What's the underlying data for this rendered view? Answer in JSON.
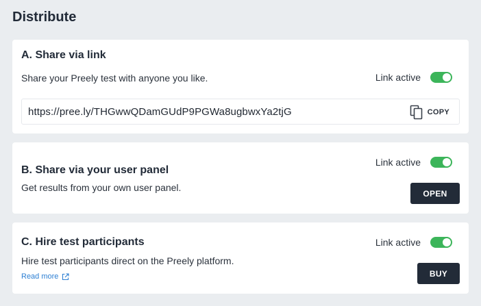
{
  "page": {
    "title": "Distribute"
  },
  "colors": {
    "toggle_on": "#3cb55a",
    "dark_button": "#222b38",
    "link": "#2d7fd3"
  },
  "share_link": {
    "title": "A. Share via link",
    "description": "Share your Preely test with anyone you like.",
    "toggle_label": "Link active",
    "toggle_on": true,
    "url": "https://pree.ly/THGwwQDamGUdP9PGWa8ugbwxYa2tjG",
    "copy_label": "COPY",
    "copy_icon": "copy-icon"
  },
  "user_panel": {
    "title": "B. Share via your user panel",
    "description": "Get results from your own user panel.",
    "toggle_label": "Link active",
    "toggle_on": true,
    "button_label": "OPEN"
  },
  "participants": {
    "title": "C. Hire test participants",
    "description": "Hire test participants direct on the Preely platform.",
    "toggle_label": "Link active",
    "toggle_on": true,
    "read_more": "Read more",
    "read_more_icon": "external-link-icon",
    "button_label": "BUY"
  }
}
